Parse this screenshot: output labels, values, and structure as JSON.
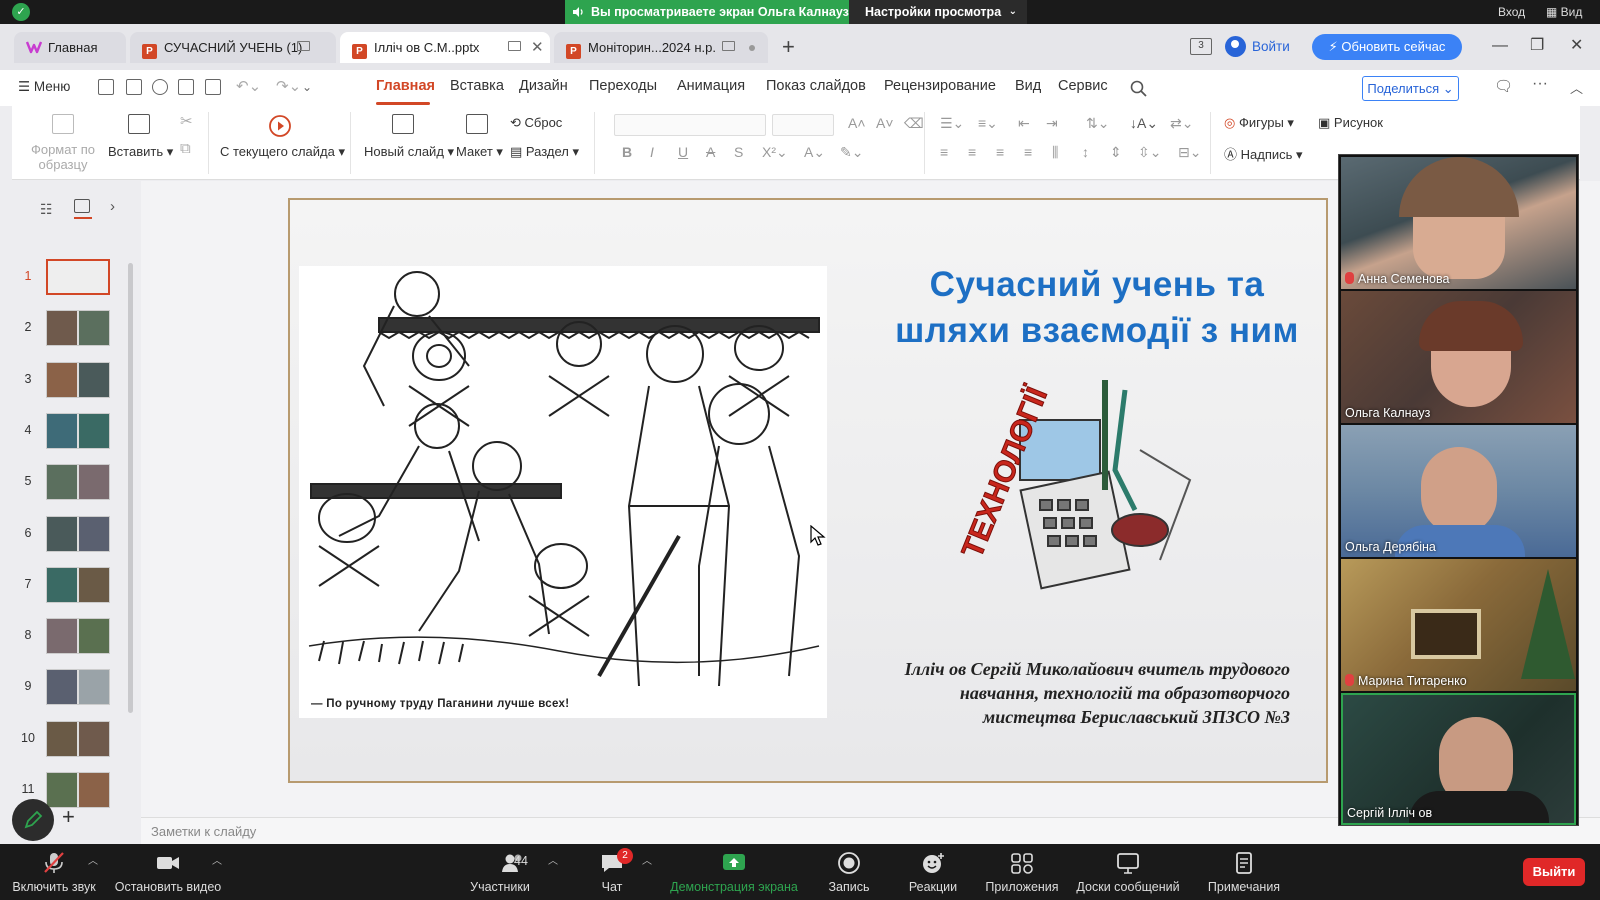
{
  "share_bar": {
    "status": "Вы просматриваете экран Ольга Калнауз",
    "settings": "Настройки просмотра",
    "login": "Вход",
    "view": "Вид"
  },
  "tabs": [
    {
      "label": "Главная"
    },
    {
      "label": "СУЧАСНИЙ УЧЕНЬ (1)"
    },
    {
      "label": "Ілліч ов С.М..pptx"
    },
    {
      "label": "Моніторин...2024 н.р."
    }
  ],
  "titlebar": {
    "badge_count": "3",
    "login": "Войти",
    "update": "Обновить сейчас"
  },
  "menu": {
    "menu_label": "Меню",
    "items": [
      "Главная",
      "Вставка",
      "Дизайн",
      "Переходы",
      "Анимация",
      "Показ слайдов",
      "Рецензирование",
      "Вид",
      "Сервис"
    ],
    "share": "Поделиться"
  },
  "ribbon": {
    "format_painter": "Формат по образцу",
    "paste": "Вставить",
    "from_current": "С текущего слайда",
    "new_slide": "Новый слайд",
    "layout": "Макет",
    "reset": "Сброс",
    "section": "Раздел",
    "shapes": "Фигуры",
    "picture": "Рисунок",
    "textbox": "Надпись"
  },
  "thumbnails": [
    "1",
    "2",
    "3",
    "4",
    "5",
    "6",
    "7",
    "8",
    "9",
    "10",
    "11"
  ],
  "slide": {
    "title_line1": "Сучасний учень та",
    "title_line2": "шляхи взаємодії з ним",
    "logo_text": "ТЕХНОЛОГІЇ",
    "caption": "— По ручному труду Паганини лучше всех!",
    "author_line1": "Ілліч ов  Сергій Миколайович вчитель трудового",
    "author_line2": "навчання, технологій та образотворчого",
    "author_line3": "мистецтва Бериславський ЗПЗСО №3"
  },
  "notes_placeholder": "Заметки к слайду",
  "participants": [
    {
      "name": "Анна Семенова",
      "muted": true
    },
    {
      "name": "Ольга Калнауз",
      "muted": false
    },
    {
      "name": "Ольга Дерябіна",
      "muted": false
    },
    {
      "name": "Марина Титаренко",
      "muted": true
    },
    {
      "name": "Сергій Ілліч ов",
      "muted": false
    }
  ],
  "bottom_bar": {
    "unmute": "Включить звук",
    "stop_video": "Остановить видео",
    "participants": "Участники",
    "participants_count": "44",
    "chat": "Чат",
    "chat_badge": "2",
    "share_screen": "Демонстрация экрана",
    "record": "Запись",
    "reactions": "Реакции",
    "apps": "Приложения",
    "whiteboards": "Доски сообщений",
    "notes": "Примечания",
    "leave": "Выйти"
  },
  "colors": {
    "accent_ppt": "#d24726",
    "share_green": "#2ea44f",
    "title_blue": "#1d6fc4",
    "leave_red": "#e02828",
    "update_blue": "#3b82f6"
  }
}
